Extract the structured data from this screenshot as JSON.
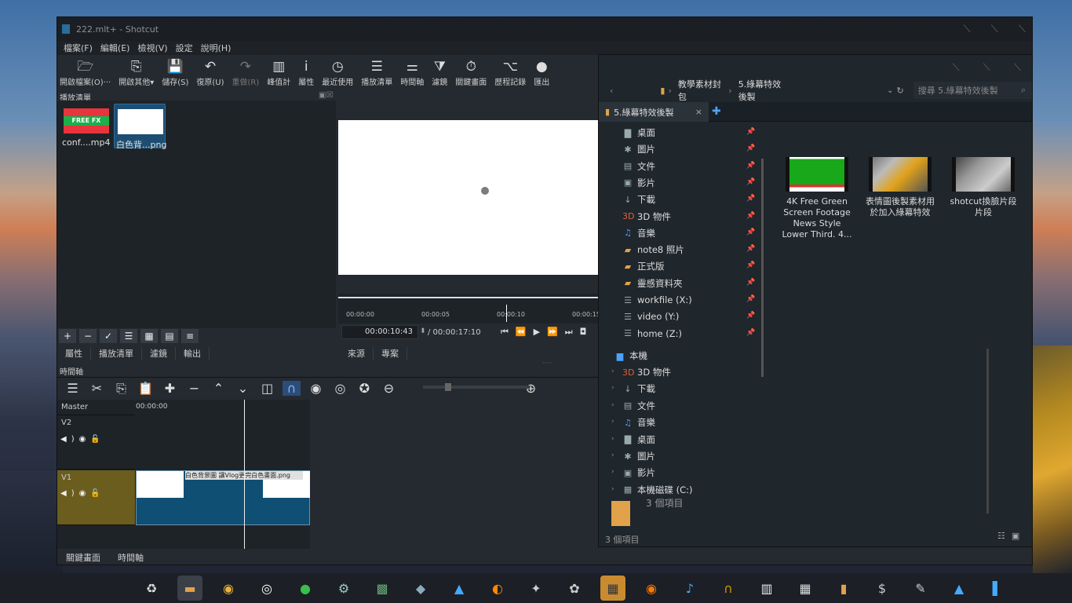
{
  "shotcut": {
    "title": "222.mlt+ - Shotcut",
    "menu": [
      "檔案(F)",
      "編輯(E)",
      "檢視(V)",
      "設定",
      "說明(H)"
    ],
    "toolbar": [
      {
        "icon": "folder-open-icon",
        "glyph": "🗁",
        "label": "開啟檔案(O)···"
      },
      {
        "icon": "open-other-icon",
        "glyph": "⎘",
        "label": "開啟其他▾"
      },
      {
        "icon": "save-icon",
        "glyph": "💾",
        "label": "儲存(S)"
      },
      {
        "icon": "undo-icon",
        "glyph": "↶",
        "label": "復原(U)"
      },
      {
        "icon": "redo-icon",
        "glyph": "↷",
        "label": "重做(R)"
      },
      {
        "icon": "peak-meter-icon",
        "glyph": "▥",
        "label": "峰值計"
      },
      {
        "icon": "info-icon",
        "glyph": "i",
        "label": "屬性"
      },
      {
        "icon": "recent-icon",
        "glyph": "◷",
        "label": "最近使用"
      },
      {
        "icon": "playlist-icon",
        "glyph": "☰",
        "label": "播放清單"
      },
      {
        "icon": "timeline-icon",
        "glyph": "⚌",
        "label": "時間軸"
      },
      {
        "icon": "filter-icon",
        "glyph": "⧩",
        "label": "濾鏡"
      },
      {
        "icon": "keyframe-icon",
        "glyph": "⏱",
        "label": "關鍵畫面"
      },
      {
        "icon": "history-icon",
        "glyph": "⌥",
        "label": "歷程記錄"
      },
      {
        "icon": "export-icon",
        "glyph": "●",
        "label": "匯出"
      }
    ],
    "playlist": {
      "header": "播放清單",
      "items": [
        {
          "label": "conf....mp4",
          "badge": "FREE FX"
        },
        {
          "label": "白色背...png"
        }
      ],
      "buttons": [
        "+",
        "−",
        "✓",
        "☰",
        "▦",
        "▤",
        "≡"
      ],
      "tabs": [
        "屬性",
        "播放清單",
        "濾鏡",
        "輸出"
      ]
    },
    "player": {
      "ticks": [
        "00:00:00",
        "00:00:05",
        "00:00:10",
        "00:00:15"
      ],
      "timecode": "00:00:10:43",
      "duration": "/ 00:00:17:10",
      "tabs": [
        "來源",
        "專案"
      ]
    },
    "timeline": {
      "header": "時間軸",
      "ruler_start": "00:00:00",
      "tracks": [
        {
          "name": "Master"
        },
        {
          "name": "V2"
        },
        {
          "name": "V1"
        }
      ],
      "clip_label": "白色背景圖 讓Vlog更完白色畫面.png"
    },
    "bottom_tabs": [
      "關鍵畫面",
      "時間軸"
    ]
  },
  "explorer": {
    "breadcrumb": [
      "教學素材封包",
      "5.綠幕特效後製"
    ],
    "search_placeholder": "搜尋 5.綠幕特效後製",
    "tab": "5.綠幕特效後製",
    "quick": [
      {
        "icon": "desktop-icon",
        "glyph": "▇",
        "label": "桌面"
      },
      {
        "icon": "pictures-icon",
        "glyph": "✱",
        "label": "圖片"
      },
      {
        "icon": "documents-icon",
        "glyph": "▤",
        "label": "文件"
      },
      {
        "icon": "videos-icon",
        "glyph": "▣",
        "label": "影片"
      },
      {
        "icon": "downloads-icon",
        "glyph": "↓",
        "label": "下載"
      },
      {
        "icon": "3d-objects-icon",
        "glyph": "3D",
        "label": "3D 物件"
      },
      {
        "icon": "music-icon",
        "glyph": "♫",
        "label": "音樂"
      },
      {
        "icon": "folder-icon",
        "glyph": "▰",
        "label": "note8 照片"
      },
      {
        "icon": "folder-icon",
        "glyph": "▰",
        "label": "正式版"
      },
      {
        "icon": "folder-icon",
        "glyph": "▰",
        "label": "靈感資料夾"
      },
      {
        "icon": "drive-icon",
        "glyph": "☰",
        "label": "workfile (X:)"
      },
      {
        "icon": "drive-icon",
        "glyph": "☰",
        "label": "video (Y:)"
      },
      {
        "icon": "drive-icon",
        "glyph": "☰",
        "label": "home (Z:)"
      }
    ],
    "thispc": "本機",
    "thispc_items": [
      {
        "icon": "3d-objects-icon",
        "glyph": "3D",
        "label": "3D 物件"
      },
      {
        "icon": "downloads-icon",
        "glyph": "↓",
        "label": "下載"
      },
      {
        "icon": "documents-icon",
        "glyph": "▤",
        "label": "文件"
      },
      {
        "icon": "music-icon",
        "glyph": "♫",
        "label": "音樂"
      },
      {
        "icon": "desktop-icon",
        "glyph": "▇",
        "label": "桌面"
      },
      {
        "icon": "pictures-icon",
        "glyph": "✱",
        "label": "圖片"
      },
      {
        "icon": "videos-icon",
        "glyph": "▣",
        "label": "影片"
      },
      {
        "icon": "drive-icon",
        "glyph": "▦",
        "label": "本機磁碟 (C:)"
      }
    ],
    "files": [
      {
        "label": "4K Free Green Screen Footage News Style Lower Third. 4..."
      },
      {
        "label": "表情圖後製素材用於加入綠幕特效"
      },
      {
        "label": "shotcut換臉片段片段"
      }
    ],
    "count": "3 個項目",
    "status": "3 個項目"
  },
  "taskbar": [
    {
      "icon": "recycle-bin-icon",
      "glyph": "♻"
    },
    {
      "icon": "file-explorer-icon",
      "glyph": "▬"
    },
    {
      "icon": "chrome-icon",
      "glyph": "◉"
    },
    {
      "icon": "obs-icon",
      "glyph": "◎"
    },
    {
      "icon": "line-icon",
      "glyph": "●"
    },
    {
      "icon": "steam-icon",
      "glyph": "⚙"
    },
    {
      "icon": "minecraft-icon",
      "glyph": "▩"
    },
    {
      "icon": "cube-icon",
      "glyph": "◆"
    },
    {
      "icon": "drop-icon",
      "glyph": "▲"
    },
    {
      "icon": "firefox-icon",
      "glyph": "◐"
    },
    {
      "icon": "inkscape-icon",
      "glyph": "✦"
    },
    {
      "icon": "gimp-icon",
      "glyph": "✿"
    },
    {
      "icon": "shotcut-icon",
      "glyph": "▦"
    },
    {
      "icon": "blender-icon",
      "glyph": "◉"
    },
    {
      "icon": "audacity-icon",
      "glyph": "♪"
    },
    {
      "icon": "headphone-icon",
      "glyph": "∩"
    },
    {
      "icon": "piano-icon",
      "glyph": "▥"
    },
    {
      "icon": "calculator-icon",
      "glyph": "▦"
    },
    {
      "icon": "notebook-icon",
      "glyph": "▮"
    },
    {
      "icon": "installer-icon",
      "glyph": "$"
    },
    {
      "icon": "editor-icon",
      "glyph": "✎"
    },
    {
      "icon": "image-viewer-icon",
      "glyph": "▲"
    },
    {
      "icon": "app-icon",
      "glyph": "▌"
    }
  ],
  "colors": {
    "accent": "#2b6ea8",
    "track_v1": "#6b5d1e",
    "clip": "#0f4f74"
  }
}
